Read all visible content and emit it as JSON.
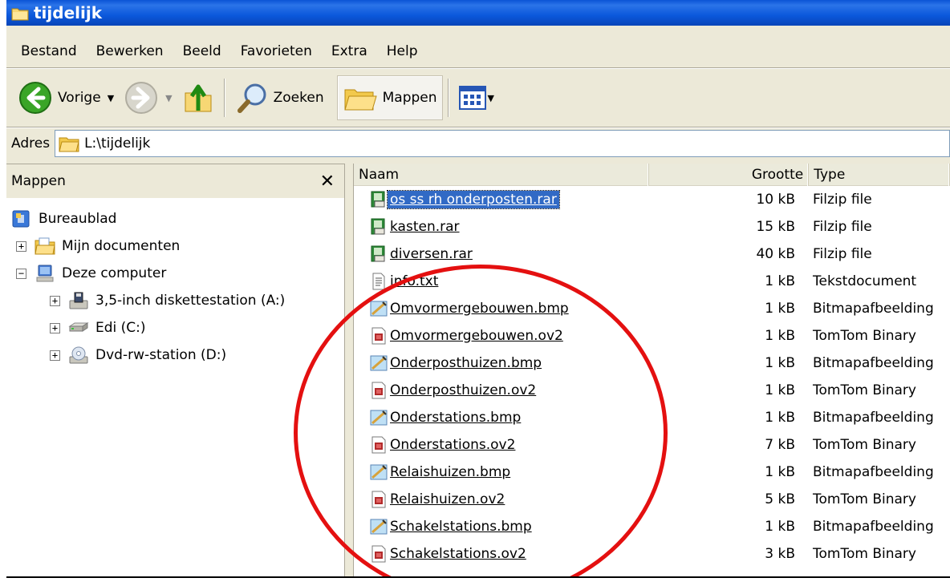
{
  "window": {
    "title": "tijdelijk"
  },
  "menu": [
    "Bestand",
    "Bewerken",
    "Beeld",
    "Favorieten",
    "Extra",
    "Help"
  ],
  "toolbar": {
    "back_label": "Vorige",
    "search_label": "Zoeken",
    "folders_label": "Mappen"
  },
  "address": {
    "label": "Adres",
    "value": "L:\\tijdelijk"
  },
  "folders_pane": {
    "title": "Mappen",
    "tree": [
      {
        "label": "Bureaublad",
        "icon": "desktop-icon",
        "expander": ""
      },
      {
        "label": "Mijn documenten",
        "icon": "my-documents-icon",
        "expander": "+"
      },
      {
        "label": "Deze computer",
        "icon": "my-computer-icon",
        "expander": "−"
      },
      {
        "label": "3,5-inch diskettestation (A:)",
        "icon": "floppy-drive-icon",
        "expander": "+"
      },
      {
        "label": "Edi (C:)",
        "icon": "hard-drive-icon",
        "expander": "+"
      },
      {
        "label": "Dvd-rw-station (D:)",
        "icon": "dvd-drive-icon",
        "expander": "+"
      }
    ]
  },
  "file_list": {
    "columns": {
      "name": "Naam",
      "size": "Grootte",
      "type": "Type"
    },
    "files": [
      {
        "name": "os ss rh onderposten.rar",
        "size": "10 kB",
        "type": "Filzip file",
        "icon": "rar-archive-icon",
        "selected": true
      },
      {
        "name": "kasten.rar",
        "size": "15 kB",
        "type": "Filzip file",
        "icon": "rar-archive-icon"
      },
      {
        "name": "diversen.rar",
        "size": "40 kB",
        "type": "Filzip file",
        "icon": "rar-archive-icon"
      },
      {
        "name": "info.txt",
        "size": "1 kB",
        "type": "Tekstdocument",
        "icon": "text-file-icon"
      },
      {
        "name": "Omvormergebouwen.bmp",
        "size": "1 kB",
        "type": "Bitmapafbeelding",
        "icon": "bitmap-file-icon"
      },
      {
        "name": "Omvormergebouwen.ov2",
        "size": "1 kB",
        "type": "TomTom Binary",
        "icon": "tomtom-file-icon"
      },
      {
        "name": "Onderposthuizen.bmp",
        "size": "1 kB",
        "type": "Bitmapafbeelding",
        "icon": "bitmap-file-icon"
      },
      {
        "name": "Onderposthuizen.ov2",
        "size": "1 kB",
        "type": "TomTom Binary",
        "icon": "tomtom-file-icon"
      },
      {
        "name": "Onderstations.bmp",
        "size": "1 kB",
        "type": "Bitmapafbeelding",
        "icon": "bitmap-file-icon"
      },
      {
        "name": "Onderstations.ov2",
        "size": "7 kB",
        "type": "TomTom Binary",
        "icon": "tomtom-file-icon"
      },
      {
        "name": "Relaishuizen.bmp",
        "size": "1 kB",
        "type": "Bitmapafbeelding",
        "icon": "bitmap-file-icon"
      },
      {
        "name": "Relaishuizen.ov2",
        "size": "5 kB",
        "type": "TomTom Binary",
        "icon": "tomtom-file-icon"
      },
      {
        "name": "Schakelstations.bmp",
        "size": "1 kB",
        "type": "Bitmapafbeelding",
        "icon": "bitmap-file-icon"
      },
      {
        "name": "Schakelstations.ov2",
        "size": "3 kB",
        "type": "TomTom Binary",
        "icon": "tomtom-file-icon"
      }
    ]
  },
  "colors": {
    "titlebar": "#0a53d6",
    "selection": "#316ac5",
    "annotation": "#e41010"
  }
}
